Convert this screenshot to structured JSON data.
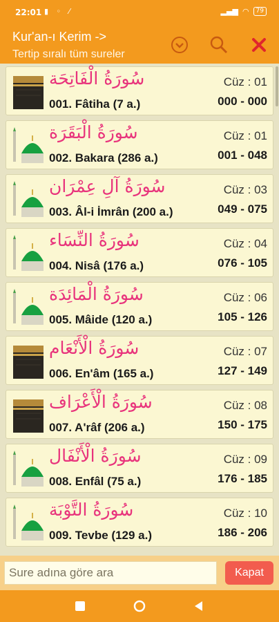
{
  "status": {
    "time": "22:01",
    "battery": "79"
  },
  "appbar": {
    "title": "Kur'an-ı Kerim ->",
    "subtitle": "Tertip sıralı tüm sureler"
  },
  "colors": {
    "accent": "#f39a1e",
    "arabic": "#e8337c",
    "close_button": "#f25c4e"
  },
  "surahs": [
    {
      "arabic": "سُورَةُ الْفَاتِحَة",
      "name": "001. Fâtiha (7 a.)",
      "juz": "Cüz : 01",
      "range": "000 - 000",
      "icon": "kaaba-icon"
    },
    {
      "arabic": "سُورَةُ الْبَقَرَة",
      "name": "002. Bakara (286 a.)",
      "juz": "Cüz : 01",
      "range": "001 - 048",
      "icon": "mosque-icon"
    },
    {
      "arabic": "سُورَةُ آلِ عِمْرَان",
      "name": "003. Âl-i İmrân (200 a.)",
      "juz": "Cüz : 03",
      "range": "049 - 075",
      "icon": "mosque-icon"
    },
    {
      "arabic": "سُورَةُ النِّسَاء",
      "name": "004. Nisâ (176 a.)",
      "juz": "Cüz : 04",
      "range": "076 - 105",
      "icon": "mosque-icon"
    },
    {
      "arabic": "سُورَةُ الْمَائِدَة",
      "name": "005. Mâide (120 a.)",
      "juz": "Cüz : 06",
      "range": "105 - 126",
      "icon": "mosque-icon"
    },
    {
      "arabic": "سُورَةُ الْأَنْعَام",
      "name": "006. En'âm (165 a.)",
      "juz": "Cüz : 07",
      "range": "127 - 149",
      "icon": "kaaba-icon"
    },
    {
      "arabic": "سُورَةُ الْأَعْرَاف",
      "name": "007. A'râf (206 a.)",
      "juz": "Cüz : 08",
      "range": "150 - 175",
      "icon": "kaaba-icon"
    },
    {
      "arabic": "سُورَةُ الْأَنْفَال",
      "name": "008. Enfâl (75 a.)",
      "juz": "Cüz : 09",
      "range": "176 - 185",
      "icon": "mosque-icon"
    },
    {
      "arabic": "سُورَةُ التَّوْبَة",
      "name": "009. Tevbe (129 a.)",
      "juz": "Cüz : 10",
      "range": "186 - 206",
      "icon": "mosque-icon"
    }
  ],
  "search": {
    "placeholder": "Sure adına göre ara",
    "close_label": "Kapat"
  }
}
